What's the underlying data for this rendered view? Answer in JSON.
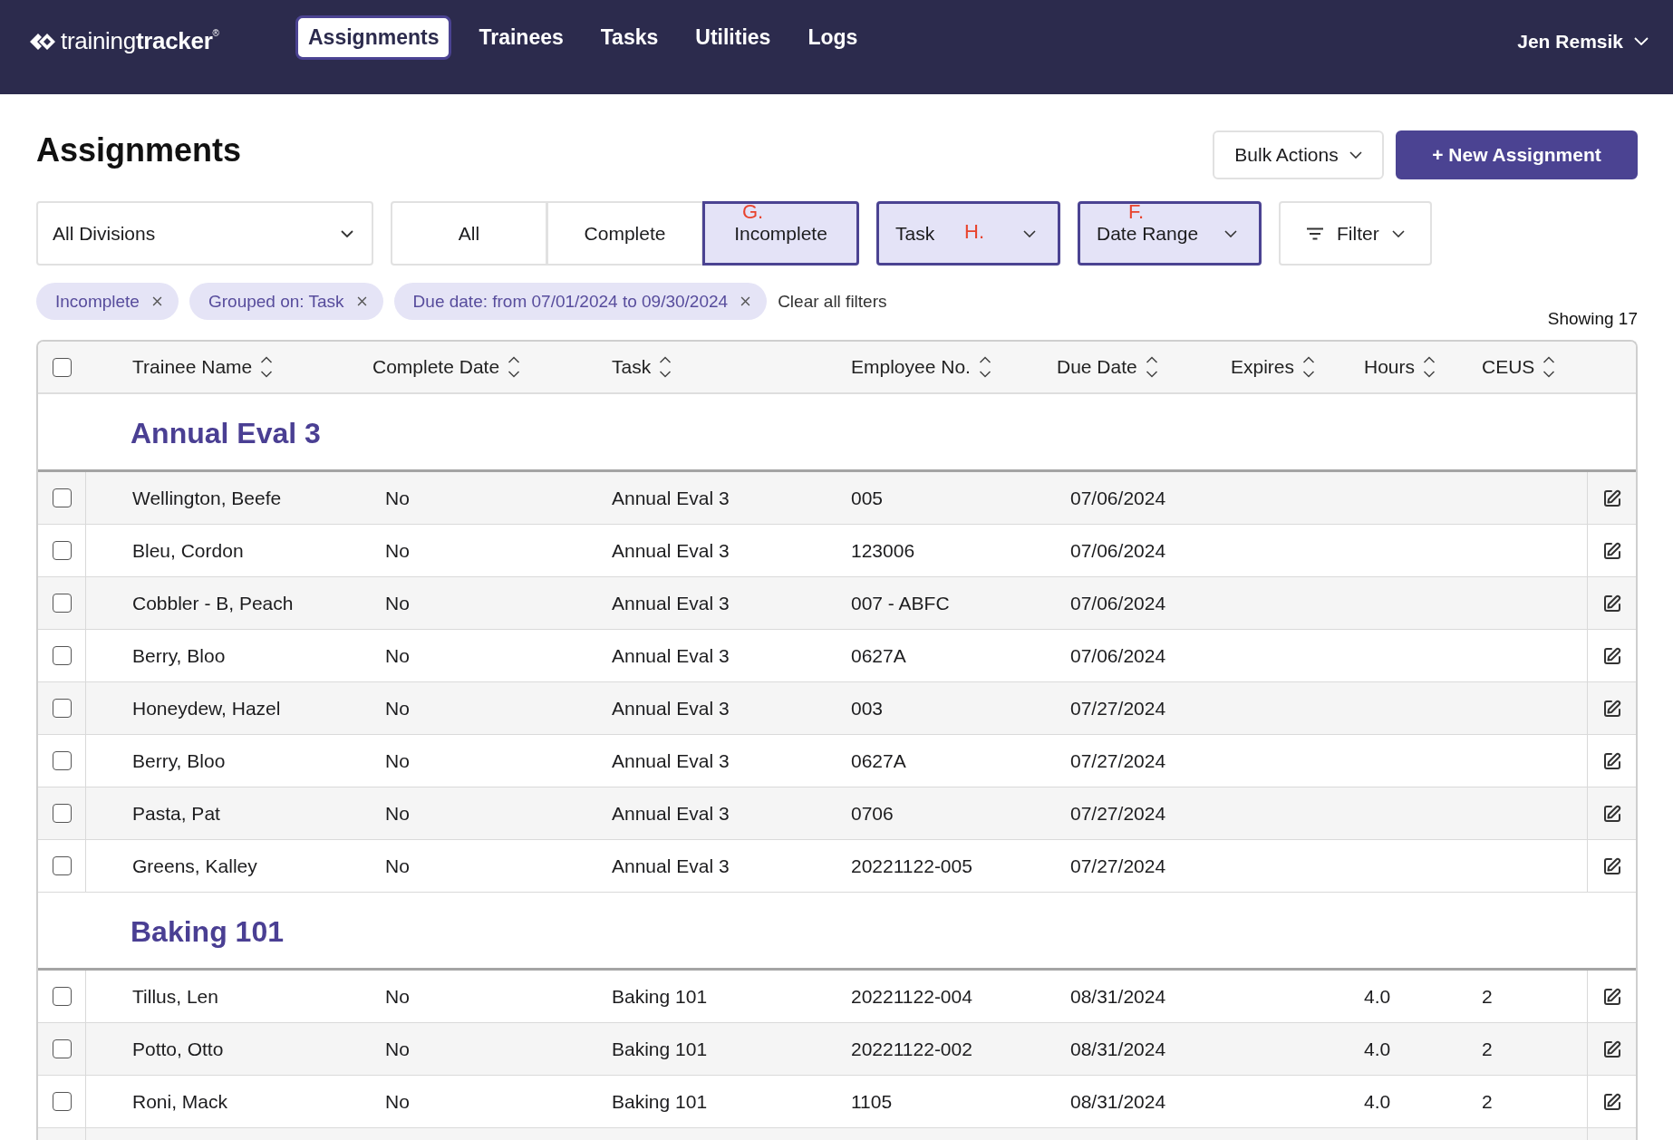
{
  "nav": {
    "logo": "training**tracker**$^{®}$",
    "items": [
      {
        "label": "Assignments",
        "selected": true
      },
      {
        "label": "Trainees",
        "selected": false
      },
      {
        "label": "Tasks",
        "selected": false
      },
      {
        "label": "Utilities",
        "selected": false
      },
      {
        "label": "Logs",
        "selected": false
      }
    ],
    "user": "Jen Remsik"
  },
  "page": {
    "title": "Assignments",
    "actions": [
      {
        "label": "Bulk Actions",
        "kind": "menu"
      },
      {
        "label": "+ New Assignment",
        "kind": "primary"
      }
    ]
  },
  "filters": {
    "division": {
      "label": "All Divisions",
      "active": false
    },
    "status": [
      {
        "label": "All",
        "selected": false
      },
      {
        "label": "Complete",
        "selected": false
      },
      {
        "label": "Incomplete",
        "selected": true,
        "annotation": "G."
      }
    ],
    "menus": [
      {
        "label": "Task",
        "kind": "select",
        "active": true,
        "annotation": "H."
      },
      {
        "label": "Date Range",
        "kind": "select",
        "active": true,
        "annotation": "F."
      },
      {
        "label": "Filter",
        "kind": "filter",
        "active": false
      }
    ]
  },
  "chips": [
    "Incomplete",
    "Grouped on: Task",
    "Due date: from 07/01/2024 to 09/30/2024"
  ],
  "clear_all": "Clear all filters",
  "showing": "Showing 17",
  "table": {
    "select_all": {
      "checked": false
    },
    "columns": [
      "Trainee Name",
      "Complete Date",
      "Task",
      "Employee No.",
      "Due Date",
      "Expires",
      "Hours",
      "CEUS"
    ],
    "groups": [
      {
        "title": "Annual Eval 3",
        "rows": [
          {
            "checked": false,
            "trainee_name": "Wellington, Beefe",
            "complete_date": "No",
            "task": "Annual Eval 3",
            "employee_no": "005",
            "due_date": "07/06/2024"
          },
          {
            "checked": false,
            "trainee_name": "Bleu, Cordon",
            "complete_date": "No",
            "task": "Annual Eval 3",
            "employee_no": "123006",
            "due_date": "07/06/2024"
          },
          {
            "checked": false,
            "trainee_name": "Cobbler - B, Peach",
            "complete_date": "No",
            "task": "Annual Eval 3",
            "employee_no": "007 - ABFC",
            "due_date": "07/06/2024"
          },
          {
            "checked": false,
            "trainee_name": "Berry, Bloo",
            "complete_date": "No",
            "task": "Annual Eval 3",
            "employee_no": "0627A",
            "due_date": "07/06/2024"
          },
          {
            "checked": false,
            "trainee_name": "Honeydew, Hazel",
            "complete_date": "No",
            "task": "Annual Eval 3",
            "employee_no": "003",
            "due_date": "07/27/2024"
          },
          {
            "checked": false,
            "trainee_name": "Berry, Bloo",
            "complete_date": "No",
            "task": "Annual Eval 3",
            "employee_no": "0627A",
            "due_date": "07/27/2024"
          },
          {
            "checked": false,
            "trainee_name": "Pasta, Pat",
            "complete_date": "No",
            "task": "Annual Eval 3",
            "employee_no": "0706",
            "due_date": "07/27/2024"
          },
          {
            "checked": false,
            "trainee_name": "Greens, Kalley",
            "complete_date": "No",
            "task": "Annual Eval 3",
            "employee_no": "20221122-005",
            "due_date": "07/27/2024"
          }
        ]
      },
      {
        "title": "Baking 101",
        "rows": [
          {
            "checked": false,
            "trainee_name": "Tillus, Len",
            "complete_date": "No",
            "task": "Baking 101",
            "employee_no": "20221122-004",
            "due_date": "08/31/2024",
            "hours": "4.0",
            "ceus": "2"
          },
          {
            "checked": false,
            "trainee_name": "Potto, Otto",
            "complete_date": "No",
            "task": "Baking 101",
            "employee_no": "20221122-002",
            "due_date": "08/31/2024",
            "hours": "4.0",
            "ceus": "2"
          },
          {
            "checked": false,
            "trainee_name": "Roni, Mack",
            "complete_date": "No",
            "task": "Baking 101",
            "employee_no": "1105",
            "due_date": "08/31/2024",
            "hours": "4.0",
            "ceus": "2"
          }
        ]
      }
    ]
  }
}
